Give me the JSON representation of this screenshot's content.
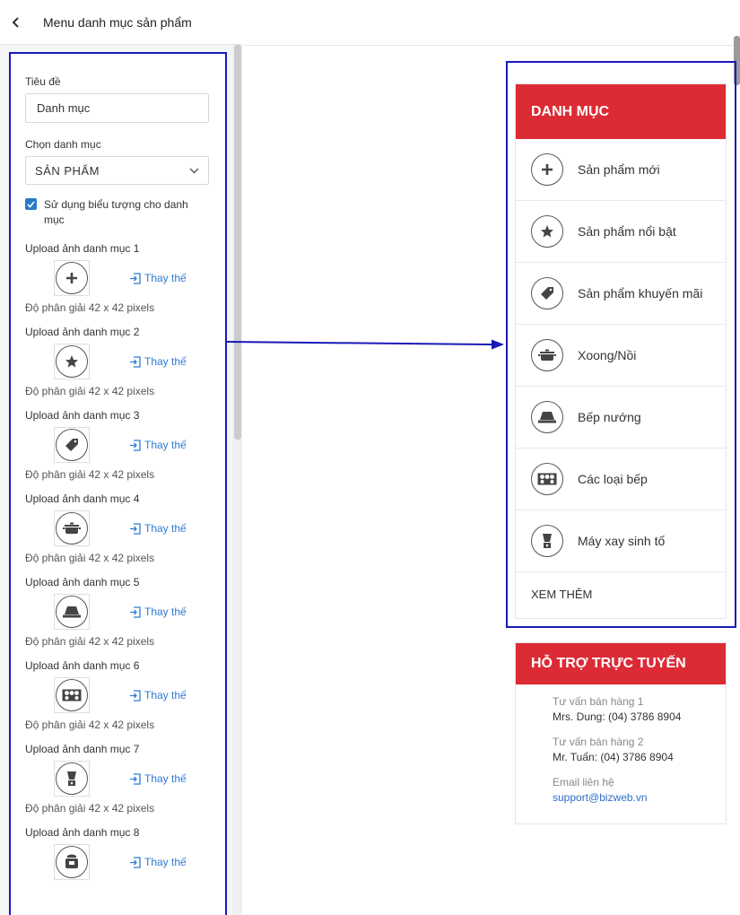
{
  "header": {
    "title": "Menu danh mục sản phẩm"
  },
  "form": {
    "title_label": "Tiêu đề",
    "title_value": "Danh mục",
    "category_label": "Chọn danh mục",
    "category_value": "SẢN PHẨM",
    "use_icon_label": "Sử dụng biểu tượng cho danh mục",
    "use_icon_checked": true,
    "replace_label": "Thay thế",
    "uploads": [
      {
        "label": "Upload ảnh danh mục 1",
        "icon": "plus-icon",
        "resolution": "Độ phân giải 42 x 42 pixels"
      },
      {
        "label": "Upload ảnh danh mục 2",
        "icon": "star-icon",
        "resolution": "Độ phân giải 42 x 42 pixels"
      },
      {
        "label": "Upload ảnh danh mục 3",
        "icon": "tag-icon",
        "resolution": "Độ phân giải 42 x 42 pixels"
      },
      {
        "label": "Upload ảnh danh mục 4",
        "icon": "pot-icon",
        "resolution": "Độ phân giải 42 x 42 pixels"
      },
      {
        "label": "Upload ảnh danh mục 5",
        "icon": "grill-icon",
        "resolution": "Độ phân giải 42 x 42 pixels"
      },
      {
        "label": "Upload ảnh danh mục 6",
        "icon": "stove-icon",
        "resolution": "Độ phân giải 42 x 42 pixels"
      },
      {
        "label": "Upload ảnh danh mục 7",
        "icon": "blender-icon",
        "resolution": "Độ phân giải 42 x 42 pixels"
      },
      {
        "label": "Upload ảnh danh mục 8",
        "icon": "cooker-icon",
        "resolution": ""
      }
    ]
  },
  "preview": {
    "category_title": "DANH MỤC",
    "items": [
      {
        "label": "Sản phẩm mới",
        "icon": "plus-icon"
      },
      {
        "label": "Sản phẩm nổi bật",
        "icon": "star-icon"
      },
      {
        "label": "Sản phẩm khuyến mãi",
        "icon": "tag-icon"
      },
      {
        "label": "Xoong/Nồi",
        "icon": "pot-icon"
      },
      {
        "label": "Bếp nướng",
        "icon": "grill-icon"
      },
      {
        "label": "Các loại bếp",
        "icon": "stove-icon"
      },
      {
        "label": "Máy xay sinh tố",
        "icon": "blender-icon"
      }
    ],
    "see_more": "XEM THÊM",
    "support": {
      "title": "HỖ TRỢ TRỰC TUYẾN",
      "contacts": [
        {
          "title": "Tư vấn bán hàng 1",
          "value": "Mrs. Dung: (04) 3786 8904"
        },
        {
          "title": "Tư vấn bán hàng 2",
          "value": "Mr. Tuấn: (04) 3786 8904"
        },
        {
          "title": "Email liên hệ",
          "value": "support@bizweb.vn"
        }
      ]
    }
  },
  "colors": {
    "accent_red": "#dd2b35",
    "highlight_blue": "#1a1ab8",
    "link_blue": "#2e7bd6"
  }
}
